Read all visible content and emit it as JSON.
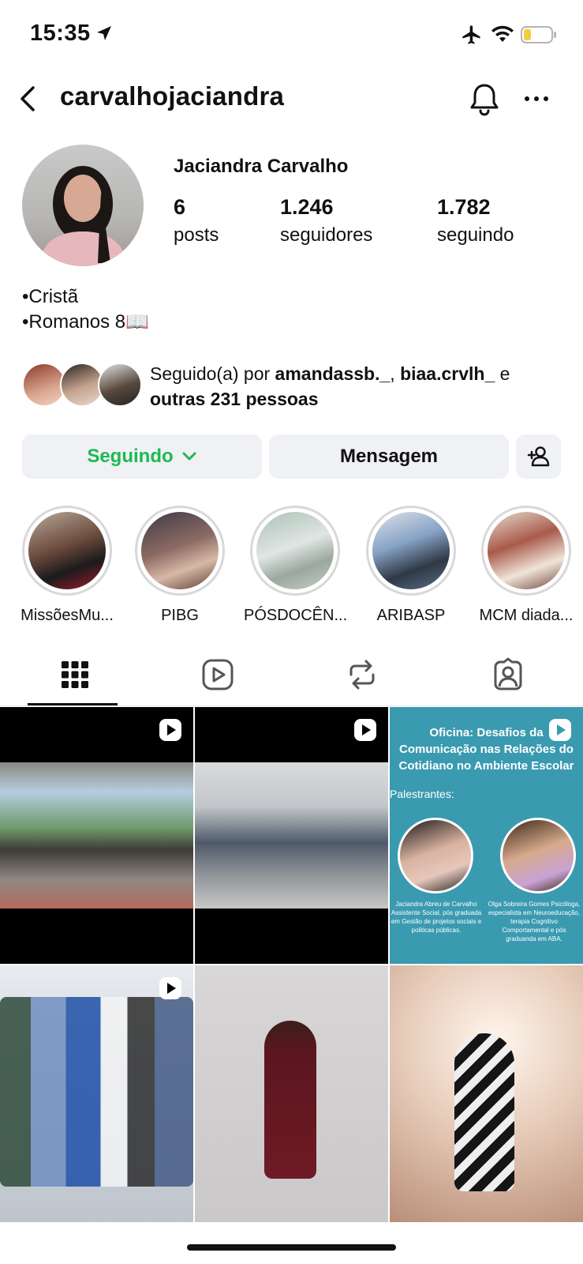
{
  "status_bar": {
    "time": "15:35",
    "icons": [
      "location-arrow-icon",
      "airplane-icon",
      "wifi-icon",
      "battery-low-icon"
    ]
  },
  "header": {
    "username": "carvalhojaciandra",
    "icons": [
      "back-chevron-icon",
      "bell-icon",
      "more-icon"
    ]
  },
  "profile": {
    "full_name": "Jaciandra Carvalho",
    "stats": [
      {
        "value": "6",
        "label": "posts"
      },
      {
        "value": "1.246",
        "label": "seguidores"
      },
      {
        "value": "1.782",
        "label": "seguindo"
      }
    ],
    "bio": [
      "•Cristã",
      "•Romanos 8📖"
    ]
  },
  "followed_by": {
    "prefix": "Seguido(a) por ",
    "user1": "amandassb._",
    "separator": ", ",
    "user2": "biaa.crvlh_",
    "conjunction": " e",
    "others": "outras 231 pessoas"
  },
  "actions": {
    "following_label": "Seguindo",
    "message_label": "Mensagem",
    "following_color": "#1db954"
  },
  "highlights": [
    {
      "label": "MissõesMu..."
    },
    {
      "label": "PIBG"
    },
    {
      "label": "PÓSDOCÊN..."
    },
    {
      "label": "ARIBASP"
    },
    {
      "label": "MCM diada..."
    }
  ],
  "tabs": [
    "grid-icon",
    "reels-icon",
    "reposts-icon",
    "tagged-icon"
  ],
  "posts": {
    "post3": {
      "title": "Oficina: Desafios da Comunicação nas Relações do Cotidiano no Ambiente Escolar",
      "subtitle": "Palestrantes:",
      "caption1": "Jaciandra Abreu de Carvalho Assistente Social, pós graduada em Gestão de projetos sociais e politicas públicas.",
      "caption2": "Olga Sobreira Gomes Psicóloga, especialista em Neuroeducação, terapia Cognitivo Comportamental e pós graduanda em ABA."
    }
  }
}
